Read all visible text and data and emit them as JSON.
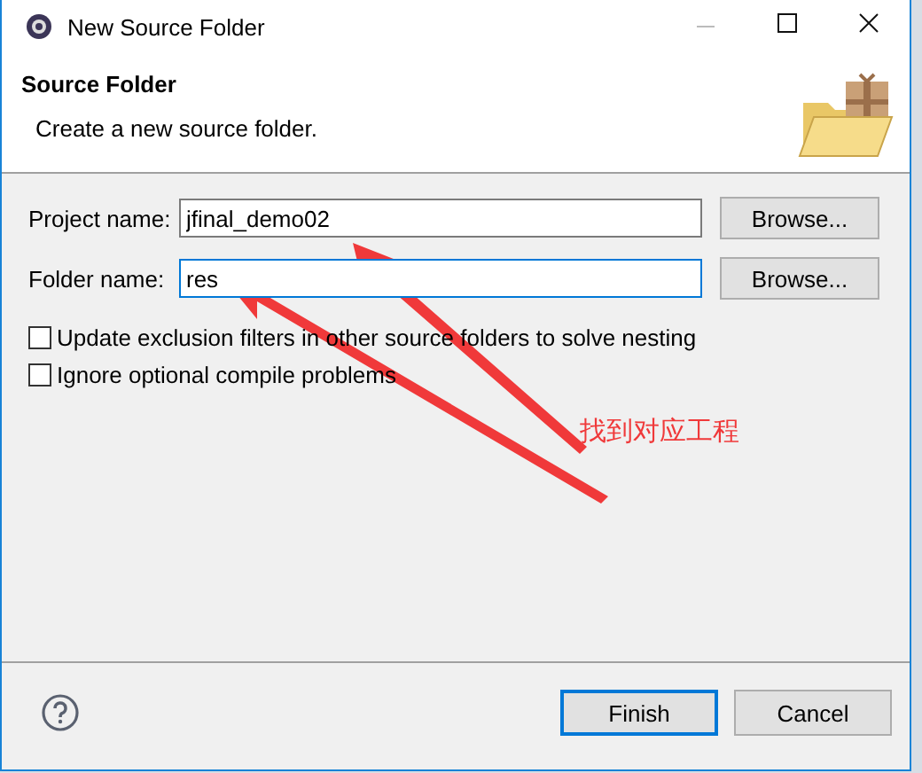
{
  "window": {
    "title": "New Source Folder"
  },
  "header": {
    "title": "Source Folder",
    "description": "Create a new source folder."
  },
  "fields": [
    {
      "label": "Project name:",
      "value": "jfinal_demo02",
      "focused": false,
      "button": "Browse..."
    },
    {
      "label": "Folder name:",
      "value": "res",
      "focused": true,
      "button": "Browse..."
    }
  ],
  "options": [
    {
      "label": "Update exclusion filters in other source folders to solve nesting",
      "checked": false
    },
    {
      "label": "Ignore optional compile problems",
      "checked": false
    }
  ],
  "annotation": {
    "text": "找到对应工程"
  },
  "buttons": [
    {
      "label": "Finish",
      "default": true
    },
    {
      "label": "Cancel",
      "default": false
    }
  ]
}
